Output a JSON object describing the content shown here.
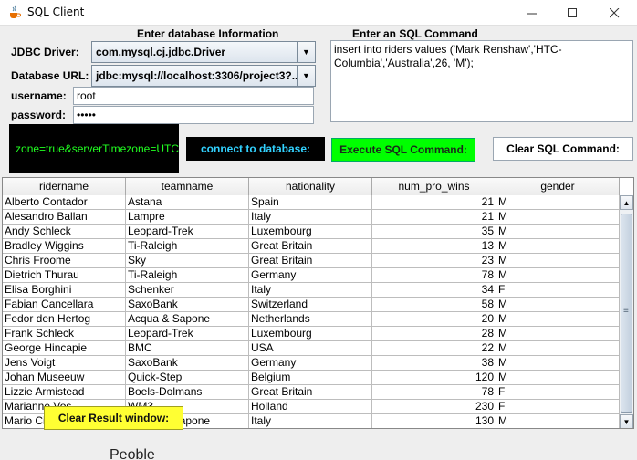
{
  "window": {
    "title": "SQL Client"
  },
  "form": {
    "db_section_title": "Enter database Information",
    "sql_section_title": "Enter an SQL Command",
    "jdbc_label": "JDBC Driver:",
    "jdbc_value": "com.mysql.cj.jdbc.Driver",
    "url_label": "Database URL:",
    "url_value": "jdbc:mysql://localhost:3306/project3?...",
    "username_label": "username:",
    "username_value": "root",
    "password_label": "password:",
    "password_value": "•••••",
    "sql_command": "insert into riders values ('Mark Renshaw','HTC-Columbia','Australia',26, 'M');"
  },
  "status": {
    "text": "zone=true&serverTimezone=UTC"
  },
  "buttons": {
    "connect": "connect to database:",
    "execute": "Execute SQL Command:",
    "clear_sql": "Clear SQL Command:",
    "clear_result": "Clear Result window:"
  },
  "table": {
    "columns": [
      "ridername",
      "teamname",
      "nationality",
      "num_pro_wins",
      "gender"
    ],
    "rows": [
      [
        "Alberto Contador",
        "Astana",
        "Spain",
        "21",
        "M"
      ],
      [
        "Alesandro Ballan",
        "Lampre",
        "Italy",
        "21",
        "M"
      ],
      [
        "Andy Schleck",
        "Leopard-Trek",
        "Luxembourg",
        "35",
        "M"
      ],
      [
        "Bradley Wiggins",
        "Ti-Raleigh",
        "Great Britain",
        "13",
        "M"
      ],
      [
        "Chris Froome",
        "Sky",
        "Great Britain",
        "23",
        "M"
      ],
      [
        "Dietrich Thurau",
        "Ti-Raleigh",
        "Germany",
        "78",
        "M"
      ],
      [
        "Elisa Borghini",
        "Schenker",
        "Italy",
        "34",
        "F"
      ],
      [
        "Fabian Cancellara",
        "SaxoBank",
        "Switzerland",
        "58",
        "M"
      ],
      [
        "Fedor den Hertog",
        "Acqua & Sapone",
        "Netherlands",
        "20",
        "M"
      ],
      [
        "Frank Schleck",
        "Leopard-Trek",
        "Luxembourg",
        "28",
        "M"
      ],
      [
        "George Hincapie",
        "BMC",
        "USA",
        "22",
        "M"
      ],
      [
        "Jens Voigt",
        "SaxoBank",
        "Germany",
        "38",
        "M"
      ],
      [
        "Johan Museeuw",
        "Quick-Step",
        "Belgium",
        "120",
        "M"
      ],
      [
        "Lizzie Armistead",
        "Boels-Dolmans",
        "Great Britain",
        "78",
        "F"
      ],
      [
        "Marianne Vos",
        "WM3",
        "Holland",
        "230",
        "F"
      ],
      [
        "Mario Cipolini",
        "Acqua & Sapone",
        "Italy",
        "130",
        "M"
      ]
    ]
  },
  "behind_window_text": "Peoble"
}
